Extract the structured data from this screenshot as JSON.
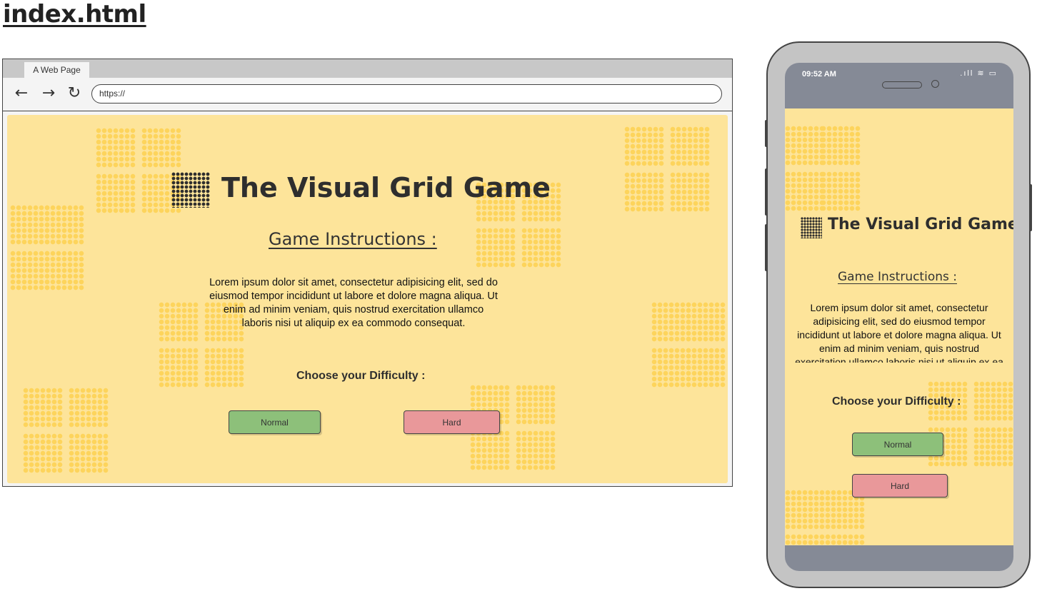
{
  "page": {
    "heading": "index.html"
  },
  "browser": {
    "tab_label": "A Web Page",
    "url": "https://",
    "back_glyph": "←",
    "forward_glyph": "→",
    "reload_glyph": "↻"
  },
  "game": {
    "title": "The Visual Grid Game",
    "instructions_title": "Game Instructions :",
    "instructions_text": "Lorem ipsum dolor sit amet, consectetur adipisicing elit, sed do eiusmod tempor incididunt ut labore et dolore magna aliqua. Ut enim ad minim veniam, quis nostrud exercitation ullamco laboris nisi ut aliquip ex ea commodo consequat.",
    "difficulty_label": "Choose your Difficulty :",
    "normal_label": "Normal",
    "hard_label": "Hard"
  },
  "phone": {
    "time": "09:52 AM",
    "status_icons": ".ıll ≋ ▭"
  },
  "icons": [
    "back-arrow-icon",
    "forward-arrow-icon",
    "reload-icon",
    "grid-logo-icon"
  ],
  "colors": {
    "background_yellow": "#fde49a",
    "dot_yellow": "#fdd45c",
    "normal_green": "#8dc07a",
    "hard_red": "#e9989a",
    "phone_bar": "#858a96"
  }
}
